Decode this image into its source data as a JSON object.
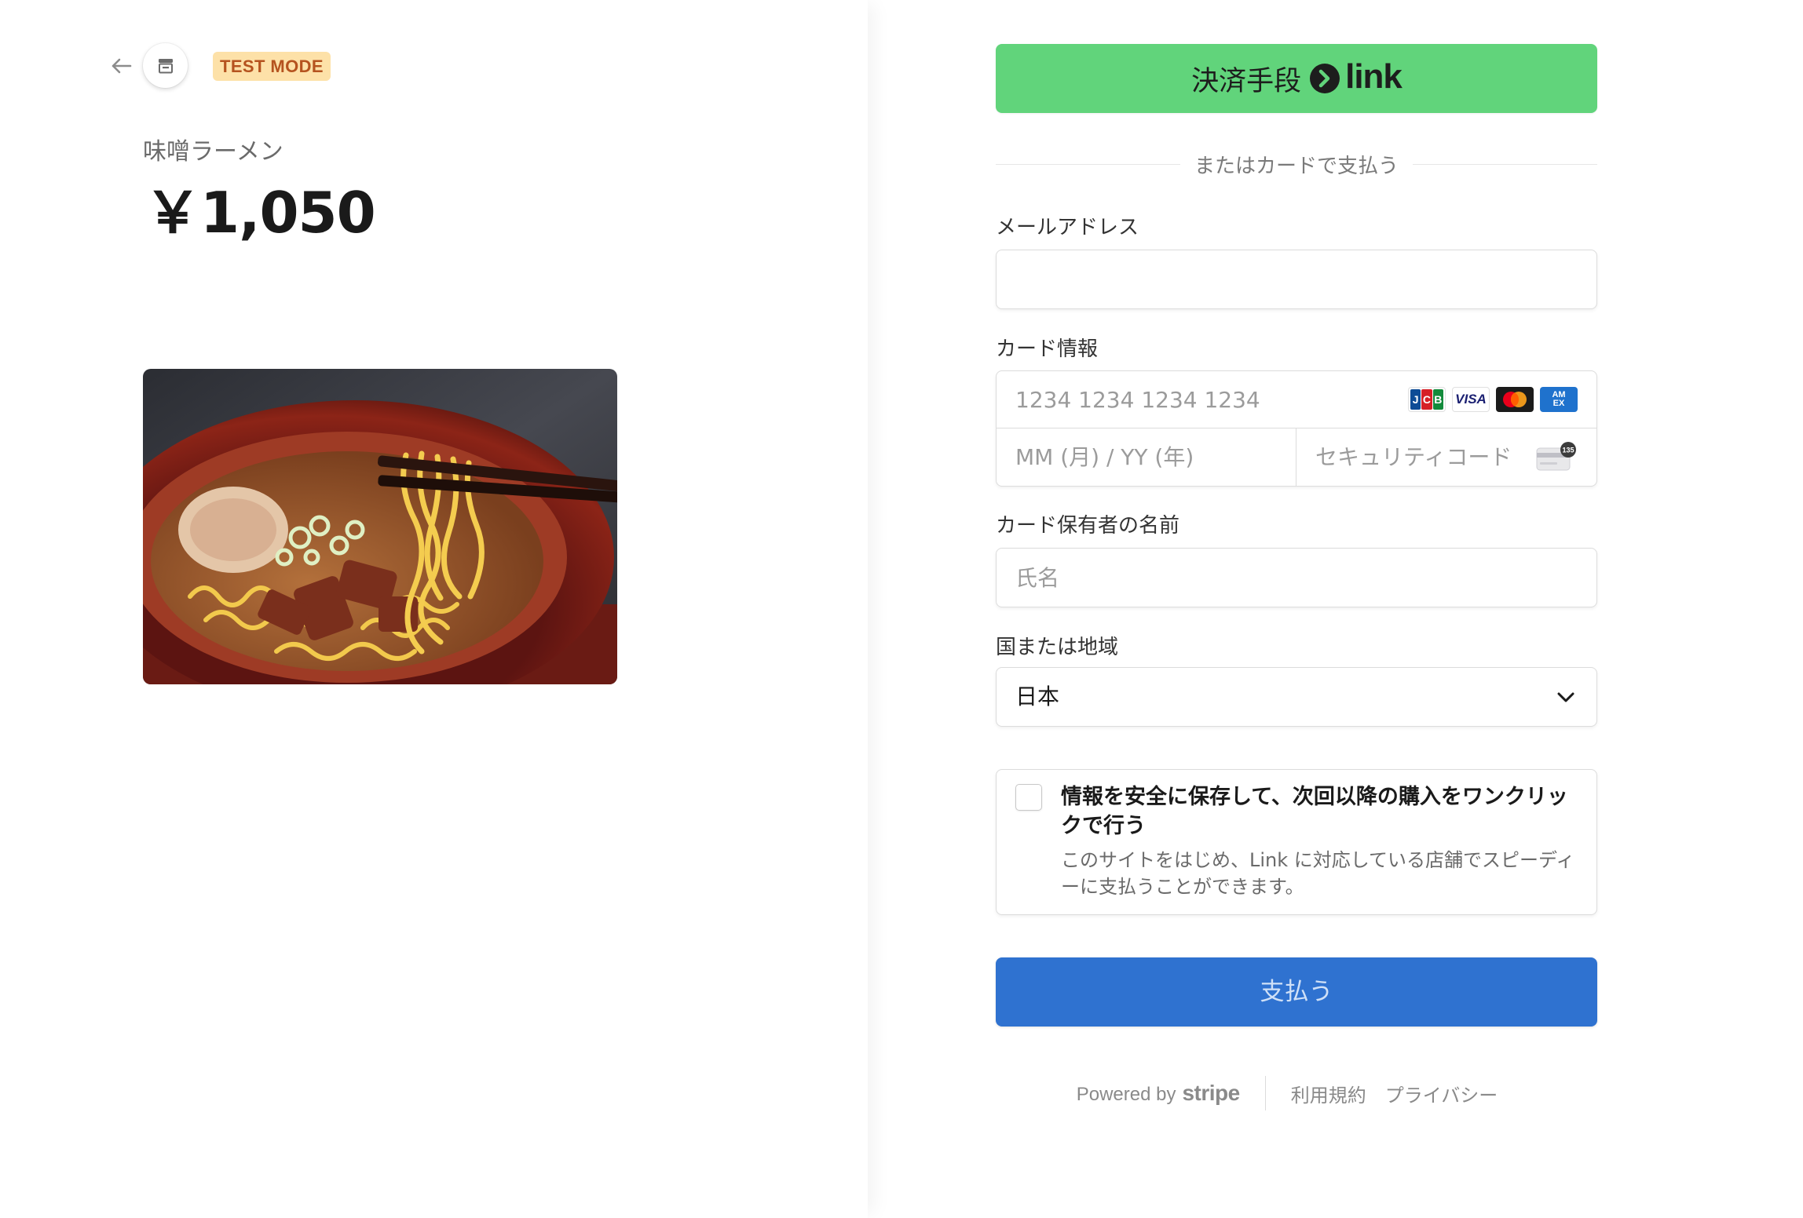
{
  "header": {
    "back_icon": "arrow-left-icon",
    "store_icon": "store-icon",
    "test_mode_badge": "TEST MODE"
  },
  "product": {
    "name": "味噌ラーメン",
    "price": "￥1,050",
    "image_alt": "ramen-photo"
  },
  "link_button": {
    "label": "決済手段",
    "brand": "link"
  },
  "divider_text": "またはカードで支払う",
  "email": {
    "label": "メールアドレス",
    "value": "",
    "placeholder": ""
  },
  "card": {
    "label": "カード情報",
    "number_placeholder": "1234 1234 1234 1234",
    "expiry_placeholder": "MM (月) / YY (年)",
    "cvc_placeholder": "セキュリティコード",
    "brands": [
      "JCB",
      "VISA",
      "Mastercard",
      "AMEX"
    ],
    "cvc_badge": "135"
  },
  "cardholder": {
    "label": "カード保有者の名前",
    "placeholder": "氏名"
  },
  "country": {
    "label": "国または地域",
    "value": "日本"
  },
  "save_info": {
    "checked": false,
    "title": "情報を安全に保存して、次回以降の購入をワンクリックで行う",
    "description": "このサイトをはじめ、Link に対応している店舗でスピーディーに支払うことができます。"
  },
  "pay_button": {
    "label": "支払う"
  },
  "footer": {
    "powered_by": "Powered by",
    "stripe": "stripe",
    "terms": "利用規約",
    "privacy": "プライバシー"
  },
  "colors": {
    "link_green": "#61d47b",
    "pay_blue": "#2f72d0",
    "badge_bg": "#fde1a8",
    "badge_text": "#b5531f"
  }
}
